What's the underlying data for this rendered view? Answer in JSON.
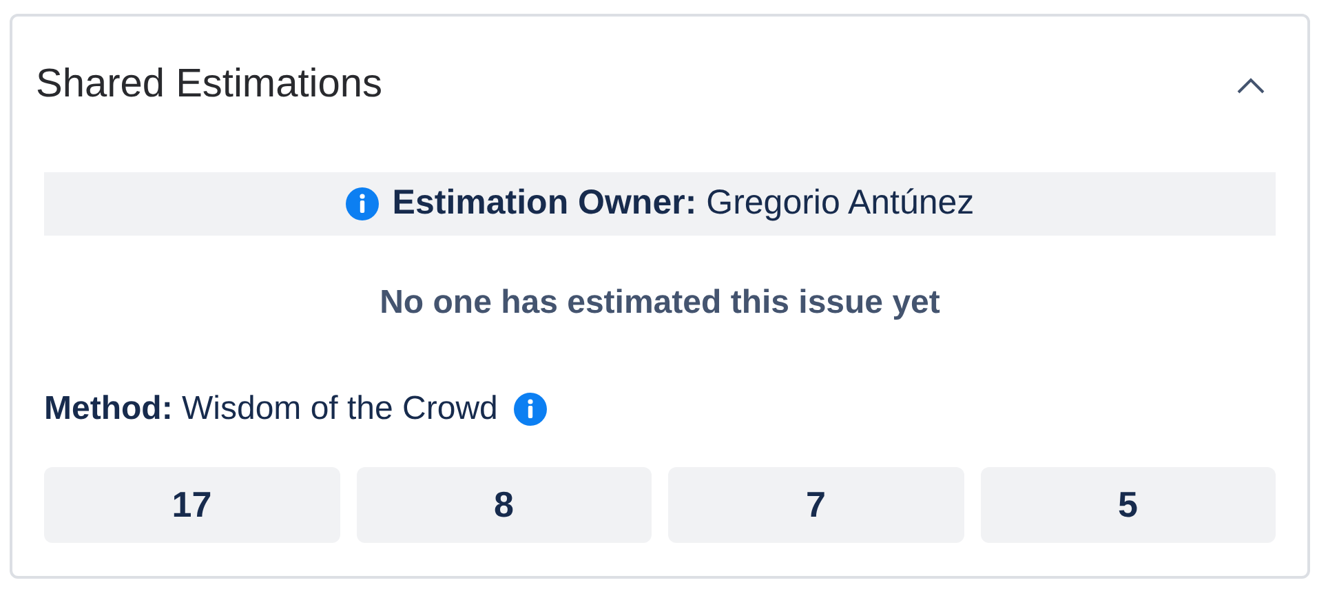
{
  "panel": {
    "title": "Shared Estimations",
    "expanded": true
  },
  "owner": "**Estimation Owner:** Gregorio Antúnez",
  "message": "No one has estimated this issue yet",
  "method": "**Method:** Wisdom of the Crowd",
  "estimate_buttons": [
    "17",
    "8",
    "7",
    "5"
  ]
}
